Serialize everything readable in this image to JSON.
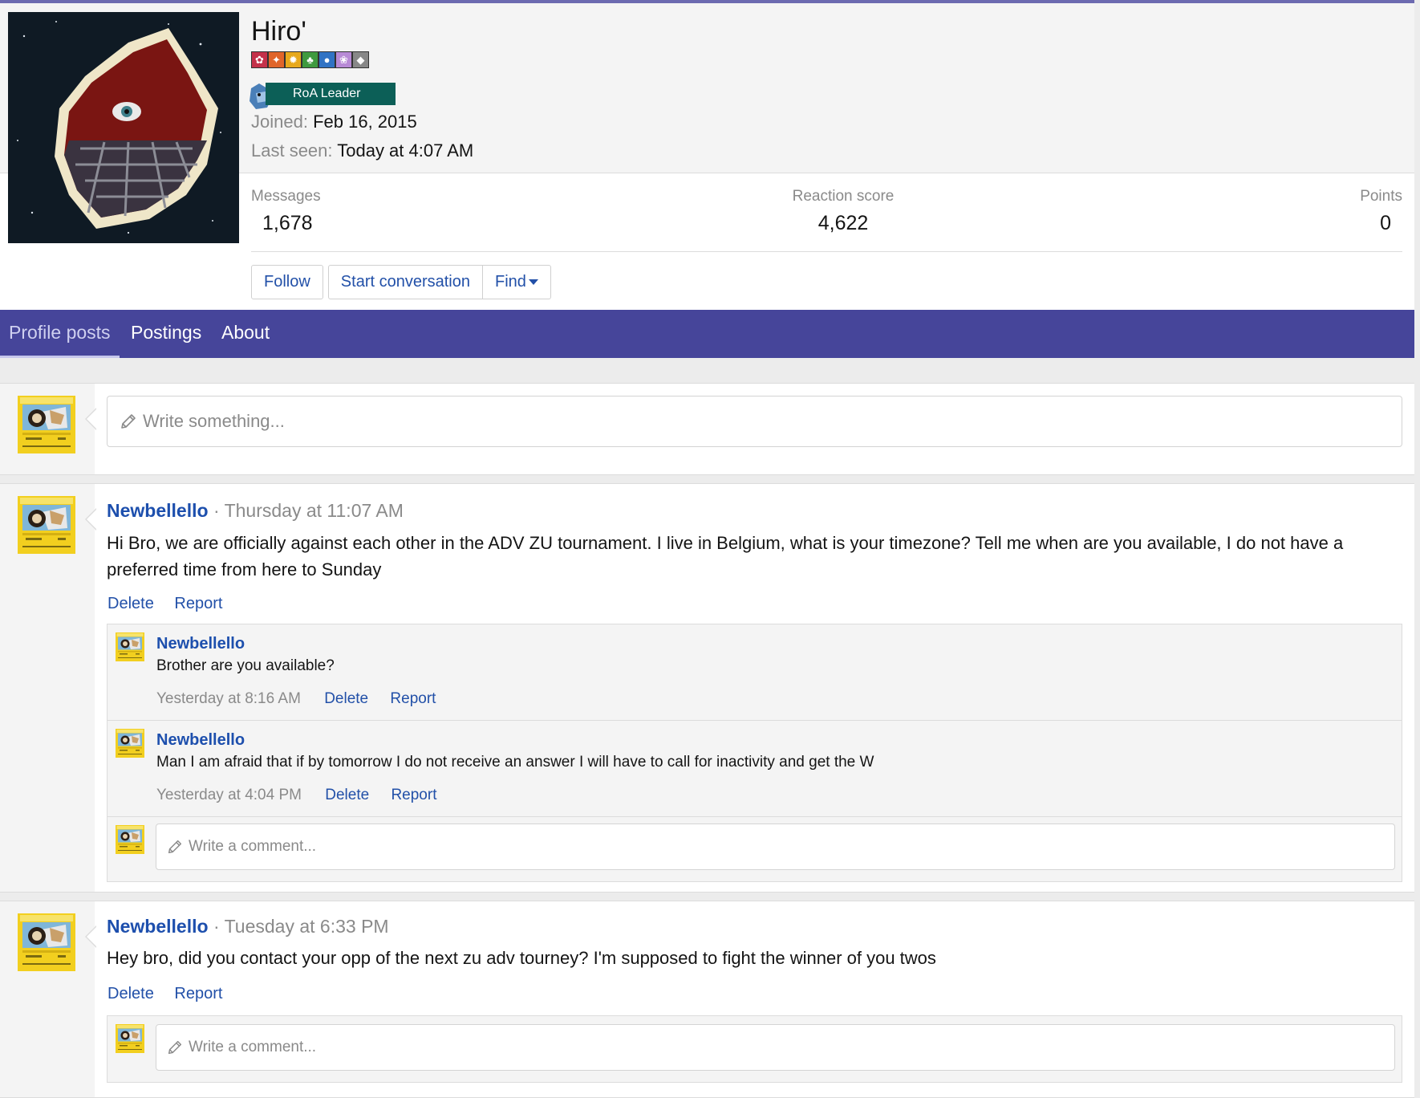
{
  "profile": {
    "username": "Hiro'",
    "banner_label": "RoA Leader",
    "joined_label": "Joined:",
    "joined_value": "Feb 16, 2015",
    "lastseen_label": "Last seen:",
    "lastseen_value": "Today at 4:07 AM",
    "badge_icons": [
      "fire-badge-icon",
      "orange-badge-icon",
      "sun-badge-icon",
      "leaf-badge-icon",
      "water-badge-icon",
      "fairy-badge-icon",
      "steel-badge-icon"
    ],
    "colors": {
      "banner": "#0c5f57",
      "nav": "#46459a",
      "link": "#2250a8",
      "accent_top": "#6c6ab0"
    }
  },
  "stats": {
    "messages_label": "Messages",
    "messages_value": "1,678",
    "reaction_label": "Reaction score",
    "reaction_value": "4,622",
    "points_label": "Points",
    "points_value": "0"
  },
  "actions": {
    "follow": "Follow",
    "start_conversation": "Start conversation",
    "find": "Find"
  },
  "tabs": {
    "profile_posts": "Profile posts",
    "postings": "Postings",
    "about": "About"
  },
  "composer": {
    "placeholder": "Write something..."
  },
  "posts": [
    {
      "author": "Newbellello",
      "separator": "·",
      "time": "Thursday at 11:07 AM",
      "message_line1": "Hi Bro, we are officially against each other in the ADV ZU tournament. I live in Belgium, what is your timezone? Tell me when are you available, I do not have a",
      "message_line2": "preferred time from here to Sunday",
      "delete": "Delete",
      "report": "Report",
      "comments": [
        {
          "author": "Newbellello",
          "text": "Brother are you available?",
          "time": "Yesterday at 8:16 AM",
          "delete": "Delete",
          "report": "Report"
        },
        {
          "author": "Newbellello",
          "text": "Man I am afraid that if by tomorrow I do not receive an answer I will have to call for inactivity and get the W",
          "time": "Yesterday at 4:04 PM",
          "delete": "Delete",
          "report": "Report"
        }
      ],
      "comment_placeholder": "Write a comment..."
    },
    {
      "author": "Newbellello",
      "separator": "·",
      "time": "Tuesday at 6:33 PM",
      "message_line1": "Hey bro, did you contact your opp of the next zu adv tourney? I'm supposed to fight the winner of you twos",
      "delete": "Delete",
      "report": "Report",
      "comment_placeholder": "Write a comment..."
    }
  ]
}
